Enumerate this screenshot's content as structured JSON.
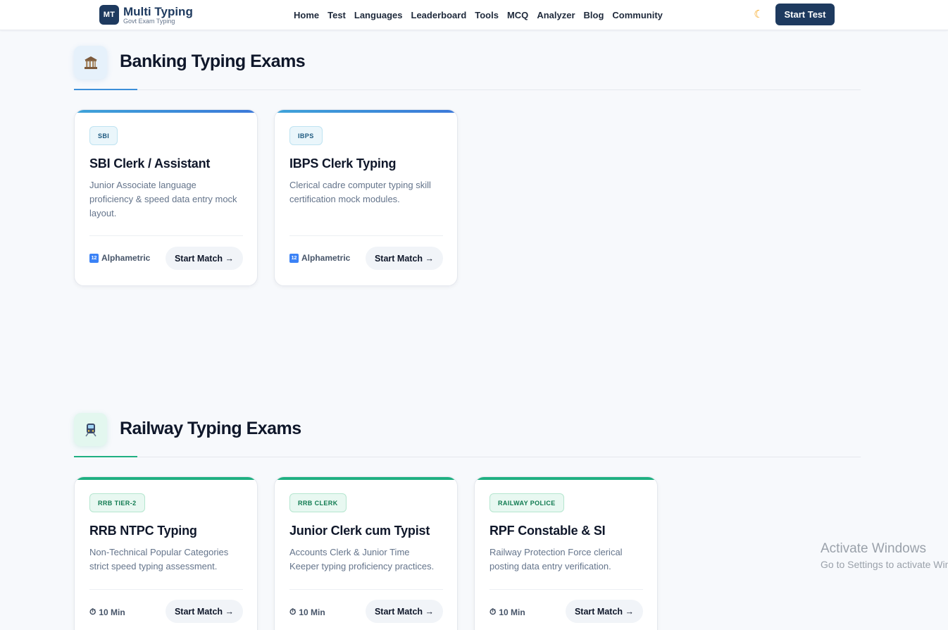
{
  "header": {
    "logo_badge": "MT",
    "logo_title": "Multi Typing",
    "logo_subtitle": "Govt Exam Typing",
    "nav": [
      "Home",
      "Test",
      "Languages",
      "Leaderboard",
      "Tools",
      "MCQ",
      "Analyzer",
      "Blog",
      "Community"
    ],
    "theme_icon": "moon-icon",
    "start_test_label": "Start Test"
  },
  "banking": {
    "icon": "bank-icon",
    "title": "Banking Typing Exams",
    "accent_color": "#3b8fd9",
    "cards": [
      {
        "tag": "SBI",
        "title": "SBI Clerk / Assistant",
        "desc": "Junior Associate language proficiency & speed data entry mock layout.",
        "meta": "Alphametric",
        "button": "Start Match →"
      },
      {
        "tag": "IBPS",
        "title": "IBPS Clerk Typing",
        "desc": "Clerical cadre computer typing skill certification mock modules.",
        "meta": "Alphametric",
        "button": "Start Match →"
      }
    ]
  },
  "railway": {
    "icon": "train-icon",
    "title": "Railway Typing Exams",
    "accent_color": "#1fb082",
    "cards": [
      {
        "tag": "RRB TIER-2",
        "title": "RRB NTPC Typing",
        "desc": "Non-Technical Popular Categories strict speed typing assessment.",
        "meta": "10 Min",
        "button": "Start Match →"
      },
      {
        "tag": "RRB CLERK",
        "title": "Junior Clerk cum Typist",
        "desc": "Accounts Clerk & Junior Time Keeper typing proficiency practices.",
        "meta": "10 Min",
        "button": "Start Match →"
      },
      {
        "tag": "RAILWAY POLICE",
        "title": "RPF Constable & SI",
        "desc": "Railway Protection Force clerical posting data entry verification.",
        "meta": "10 Min",
        "button": "Start Match →"
      }
    ]
  },
  "watermark": {
    "title": "Activate Windows",
    "subtitle": "Go to Settings to activate Windows."
  }
}
